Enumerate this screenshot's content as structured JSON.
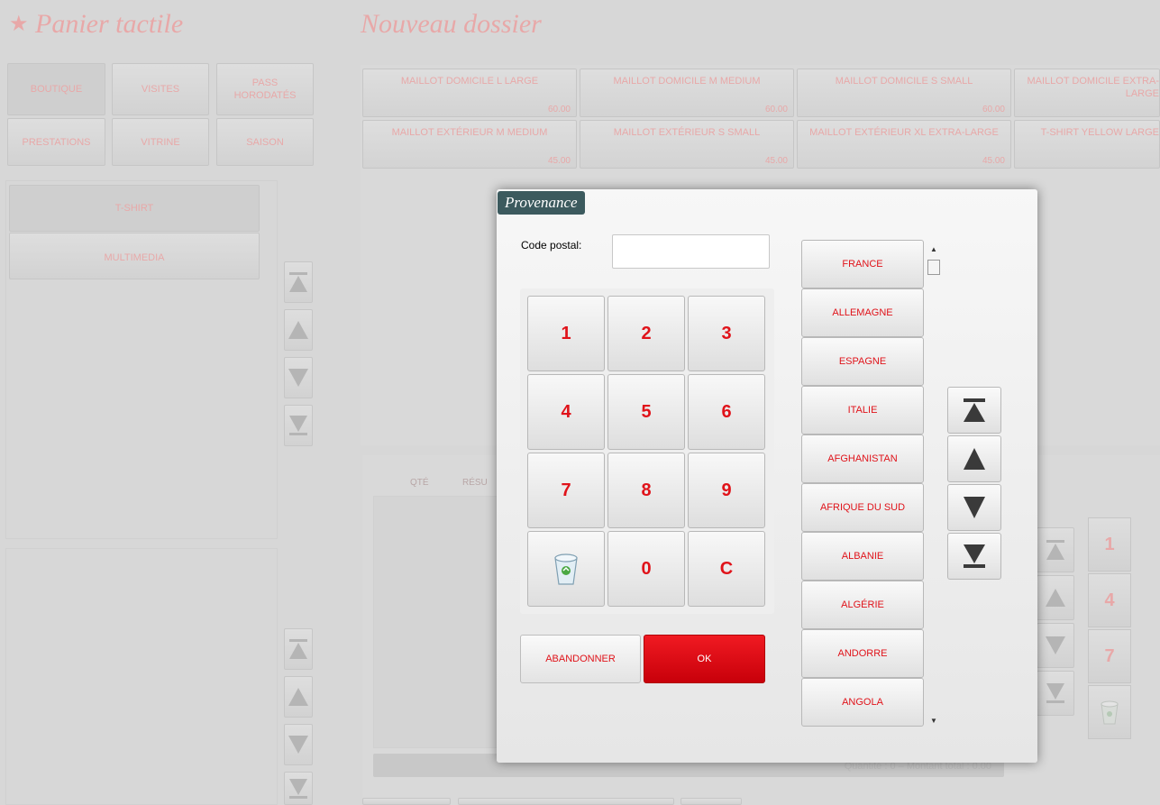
{
  "app": {
    "title": "Panier tactile",
    "dossier_title": "Nouveau dossier",
    "categories": [
      {
        "label": "BOUTIQUE"
      },
      {
        "label": "VISITES"
      },
      {
        "label": "PASS HORODATÉS"
      },
      {
        "label": "PRESTATIONS"
      },
      {
        "label": "VITRINE"
      },
      {
        "label": "SAISON"
      }
    ],
    "subcategories": [
      {
        "label": "T-SHIRT"
      },
      {
        "label": "MULTIMEDIA"
      }
    ],
    "products": [
      {
        "name": "MAILLOT DOMICILE L LARGE",
        "price": "60.00"
      },
      {
        "name": "MAILLOT DOMICILE M MEDIUM",
        "price": "60.00"
      },
      {
        "name": "MAILLOT DOMICILE S SMALL",
        "price": "60.00"
      },
      {
        "name": "MAILLOT DOMICILE EXTRA-LARGE",
        "price": ""
      },
      {
        "name": "MAILLOT EXTÉRIEUR M MEDIUM",
        "price": "45.00"
      },
      {
        "name": "MAILLOT EXTÉRIEUR S SMALL",
        "price": "45.00"
      },
      {
        "name": "MAILLOT EXTÉRIEUR XL EXTRA-LARGE",
        "price": "45.00"
      },
      {
        "name": "T-SHIRT YELLOW LARGE",
        "price": ""
      }
    ],
    "cart": {
      "col_qty": "QTÉ",
      "col_summary": "RÉSU",
      "totals": "Quantité : 0 – Montant total : 0.00"
    },
    "bg_keypad": [
      "1",
      "4",
      "7"
    ]
  },
  "modal": {
    "title": "Provenance",
    "postal_label": "Code postal:",
    "postal_value": "",
    "keys": [
      "1",
      "2",
      "3",
      "4",
      "5",
      "6",
      "7",
      "8",
      "9",
      "",
      "0",
      "C"
    ],
    "cancel_label": "ABANDONNER",
    "ok_label": "OK",
    "countries": [
      {
        "label": "FRANCE"
      },
      {
        "label": "ALLEMAGNE"
      },
      {
        "label": "ESPAGNE"
      },
      {
        "label": "ITALIE"
      },
      {
        "label": "AFGHANISTAN"
      },
      {
        "label": "AFRIQUE DU SUD"
      },
      {
        "label": "ALBANIE"
      },
      {
        "label": "ALGÉRIE"
      },
      {
        "label": "ANDORRE"
      },
      {
        "label": "ANGOLA"
      }
    ]
  },
  "colors": {
    "accent_red": "#e0131a",
    "modal_title_bg": "#3c5a5e",
    "background": "#d7d7d7"
  },
  "icons": {
    "star": "star-icon",
    "trash": "recycle-bin-icon",
    "first": "arrow-first-icon",
    "up": "arrow-up-icon",
    "down": "arrow-down-icon",
    "last": "arrow-last-icon"
  }
}
